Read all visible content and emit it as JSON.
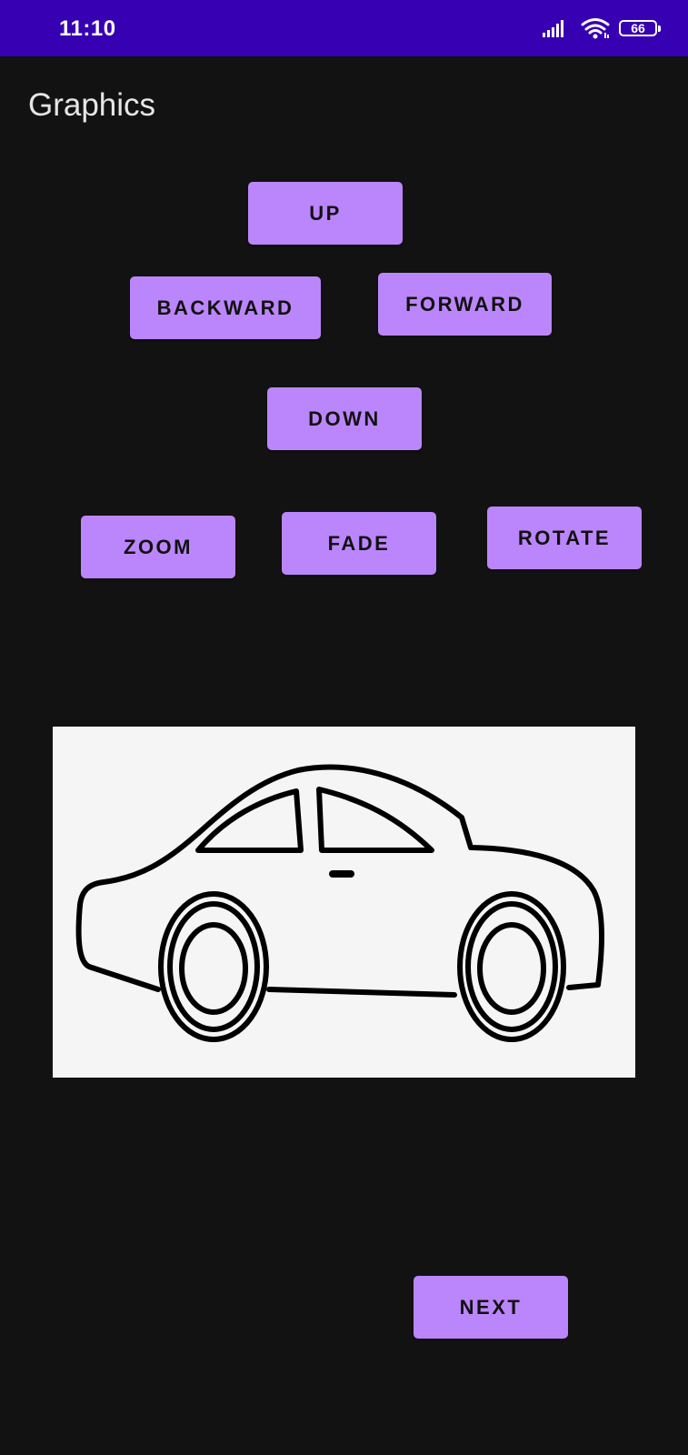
{
  "status_bar": {
    "time": "11:10",
    "battery": "66",
    "icons": [
      "signal-icon",
      "wifi-icon",
      "battery-icon"
    ],
    "color": "#3700b3"
  },
  "app": {
    "title": "Graphics"
  },
  "buttons": {
    "up": "UP",
    "backward": "BACKWARD",
    "forward": "FORWARD",
    "down": "DOWN",
    "zoom": "ZOOM",
    "fade": "FADE",
    "rotate": "ROTATE",
    "next": "NEXT"
  },
  "image": {
    "icon": "car-icon"
  },
  "colors": {
    "background": "#121212",
    "button": "#bb86fc",
    "button_text": "#111111",
    "image_background": "#f5f5f5"
  }
}
